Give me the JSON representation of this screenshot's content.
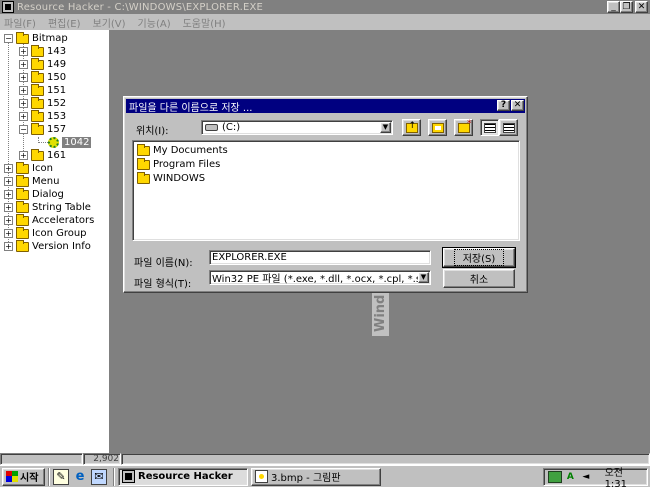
{
  "window": {
    "title": "Resource Hacker  -  C:\\WINDOWS\\EXPLORER.EXE",
    "controls": {
      "minimize": "_",
      "restore": "❐",
      "close": "✕"
    }
  },
  "menu": [
    {
      "label": "파일(F)"
    },
    {
      "label": "편집(E)"
    },
    {
      "label": "보기(V)"
    },
    {
      "label": "기능(A)"
    },
    {
      "label": "도움말(H)"
    }
  ],
  "tree": {
    "root": {
      "label": "Bitmap",
      "toggle": "−"
    },
    "bitmap_children": [
      {
        "label": "143",
        "toggle": "+"
      },
      {
        "label": "149",
        "toggle": "+"
      },
      {
        "label": "150",
        "toggle": "+"
      },
      {
        "label": "151",
        "toggle": "+"
      },
      {
        "label": "152",
        "toggle": "+"
      },
      {
        "label": "153",
        "toggle": "+"
      },
      {
        "label": "157",
        "toggle": "−"
      }
    ],
    "leaf": {
      "label": "1042"
    },
    "after_leaf": {
      "label": "161",
      "toggle": "+"
    },
    "top_level": [
      {
        "label": "Icon",
        "toggle": "+"
      },
      {
        "label": "Menu",
        "toggle": "+"
      },
      {
        "label": "Dialog",
        "toggle": "+"
      },
      {
        "label": "String Table",
        "toggle": "+"
      },
      {
        "label": "Accelerators",
        "toggle": "+"
      },
      {
        "label": "Icon Group",
        "toggle": "+"
      },
      {
        "label": "Version Info",
        "toggle": "+"
      }
    ]
  },
  "watermark_text": "Wind",
  "statusbar": {
    "pane2": "2,902"
  },
  "dialog": {
    "title": "파일을 다른 이름으로 저장 ...",
    "title_buttons": {
      "help": "?",
      "close": "✕"
    },
    "location_label": "위치(I):",
    "location_value": "(C:)",
    "combo_arrow": "▼",
    "files": [
      {
        "name": "My Documents"
      },
      {
        "name": "Program Files"
      },
      {
        "name": "WINDOWS"
      }
    ],
    "filename_label": "파일 이름(N):",
    "filename_value": "EXPLORER.EXE",
    "filetype_label": "파일 형식(T):",
    "filetype_value": "Win32 PE 파일 (*.exe, *.dll, *.ocx, *.cpl, *.s",
    "save_button": "저장(S)",
    "cancel_button": "취소"
  },
  "taskbar": {
    "start_label": "시작",
    "tasks": [
      {
        "label": "Resource Hacker"
      },
      {
        "label": "3.bmp - 그림판"
      }
    ],
    "clock": "오전 1:31",
    "tray_text": "A"
  }
}
